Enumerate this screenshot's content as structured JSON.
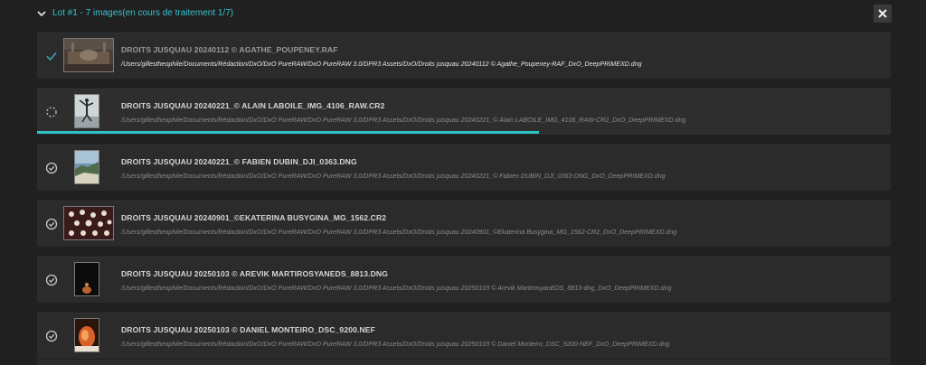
{
  "header": {
    "lot_title": "Lot  #1 - 7 images(en cours de traitement 1/7)"
  },
  "progress": {
    "current_item_fraction": 0.588
  },
  "colors": {
    "accent": "#2cc3c6",
    "done_check": "#36a8b8"
  },
  "items": [
    {
      "status": "done",
      "status_icon": "check-icon",
      "thumb": "landscape-interior",
      "title": "DROITS JUSQUAU 20240112 © AGATHE_POUPENEY.RAF",
      "path": "/Users/gillestheophile/Documents/Rédaction/DxO/DxO PureRAW/DxO PureRAW 3.0/DPR3 Assets/DxO/Droits jusquau 20240112 © Agathe_Poupeney-RAF_DxO_DeepPRIMEXD.dng"
    },
    {
      "status": "processing",
      "status_icon": "spinner-icon",
      "thumb": "portrait-dancer",
      "title": "DROITS JUSQUAU 20240221_© ALAIN LABOILE_IMG_4106_RAW.CR2",
      "path": "/Users/gillestheophile/Documents/Rédaction/DxO/DxO PureRAW/DxO PureRAW 3.0/DPR3 Assets/DxO/Droits jusquau 20240221_© Alain LABOILE_IMG_4106_RAW-CR2_DxO_DeepPRIMEXD.dng"
    },
    {
      "status": "pending",
      "status_icon": "clock-icon",
      "thumb": "portrait-coast",
      "title": "DROITS JUSQUAU 20240221_© FABIEN DUBIN_DJI_0363.DNG",
      "path": "/Users/gillestheophile/Documents/Rédaction/DxO/DxO PureRAW/DxO PureRAW 3.0/DPR3 Assets/DxO/Droits jusquau 20240221_© Fabien DUBIN_DJI_0363-DNG_DxO_DeepPRIMEXD.dng"
    },
    {
      "status": "pending",
      "status_icon": "clock-icon",
      "thumb": "landscape-pattern",
      "title": "DROITS JUSQUAU 20240901_©EKATERINA BUSYGINA_MG_1562.CR2",
      "path": "/Users/gillestheophile/Documents/Rédaction/DxO/DxO PureRAW/DxO PureRAW 3.0/DPR3 Assets/DxO/Droits jusquau 20240901_©Ekaterina Busygina_MG_1562-CR2_DxO_DeepPRIMEXD.dng"
    },
    {
      "status": "pending",
      "status_icon": "clock-icon",
      "thumb": "portrait-dark",
      "title": "DROITS JUSQUAU 20250103 © AREVIK MARTIROSYANEDS_8813.DNG",
      "path": "/Users/gillestheophile/Documents/Rédaction/DxO/DxO PureRAW/DxO PureRAW 3.0/DPR3 Assets/DxO/Droits jusquau 20250103 © Arevik MartirosyanEDS_8813-dng_DxO_DeepPRIMEXD.dng"
    },
    {
      "status": "pending",
      "status_icon": "clock-icon",
      "thumb": "portrait-fire",
      "title": "DROITS JUSQUAU 20250103 © DANIEL MONTEIRO_DSC_9200.NEF",
      "path": "/Users/gillestheophile/Documents/Rédaction/DxO/DxO PureRAW/DxO PureRAW 3.0/DPR3 Assets/DxO/Droits jusquau 20250103 © Daniel Monteiro_DSC_9200-NEF_DxO_DeepPRIMEXD.dng"
    }
  ]
}
